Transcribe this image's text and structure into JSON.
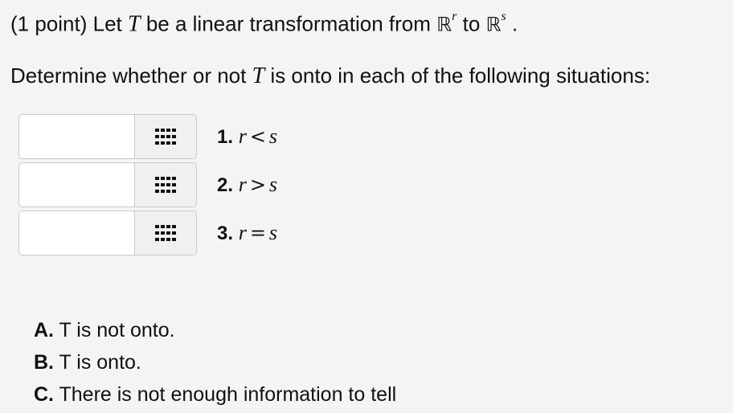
{
  "question": {
    "points": "(1 point)",
    "text_let": "Let",
    "var_T": "T",
    "text_be": "be a linear transformation from",
    "domain_set": "ℝ",
    "domain_exp": "r",
    "text_to": "to",
    "codomain_set": "ℝ",
    "codomain_exp": "s",
    "period": ".",
    "prompt_part1": "Determine whether or not",
    "prompt_part2": "is onto in each of the following situations:"
  },
  "rows": [
    {
      "number": "1.",
      "lhs": "r",
      "op": "<",
      "rhs": "s",
      "selected": ""
    },
    {
      "number": "2.",
      "lhs": "r",
      "op": ">",
      "rhs": "s",
      "selected": ""
    },
    {
      "number": "3.",
      "lhs": "r",
      "op": "=",
      "rhs": "s",
      "selected": ""
    }
  ],
  "choices": [
    {
      "letter": "A.",
      "text": "T is not onto."
    },
    {
      "letter": "B.",
      "text": "T is onto."
    },
    {
      "letter": "C.",
      "text": "There is not enough information to tell"
    }
  ],
  "icons": {
    "menu_button": "grid-icon"
  }
}
